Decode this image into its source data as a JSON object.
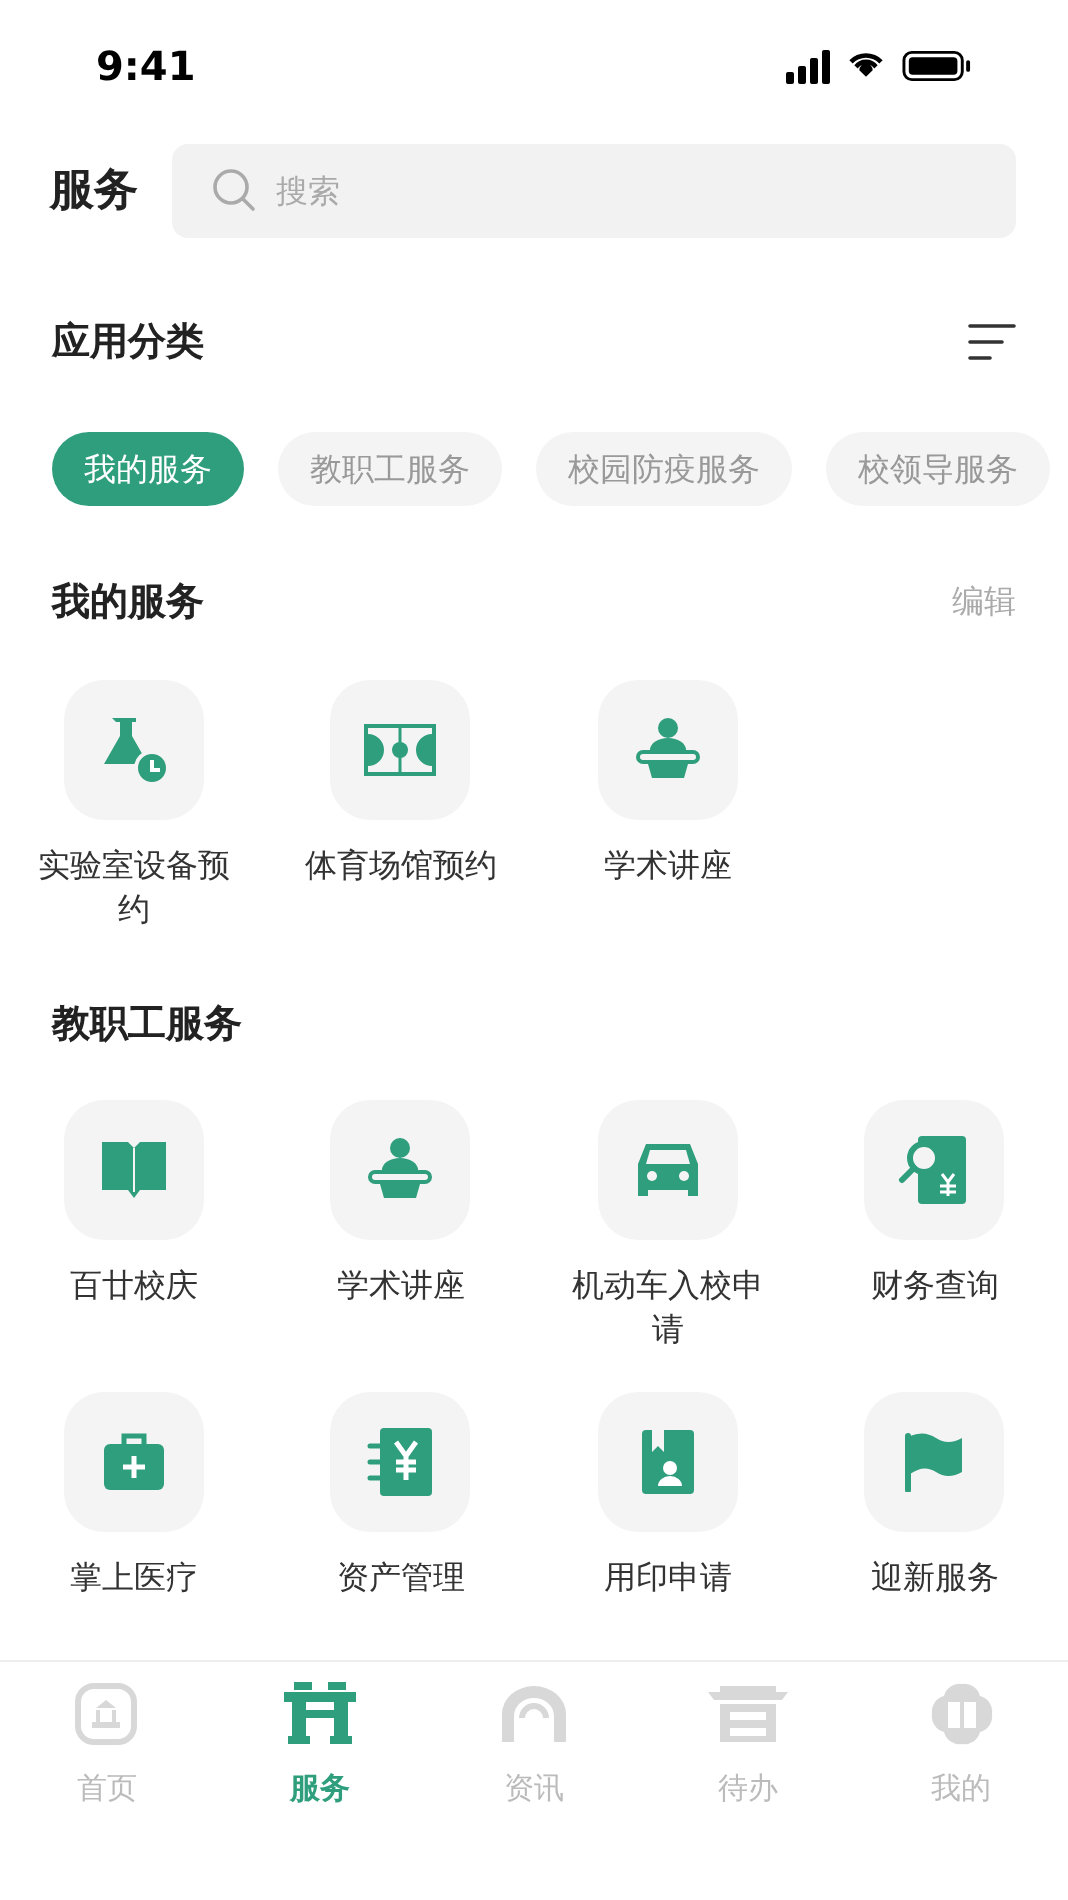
{
  "status_bar": {
    "time": "9:41"
  },
  "header": {
    "title": "服务",
    "search": {
      "placeholder": "搜索"
    }
  },
  "category": {
    "title": "应用分类"
  },
  "chips": [
    {
      "label": "我的服务",
      "selected": true
    },
    {
      "label": "教职工服务",
      "selected": false
    },
    {
      "label": "校园防疫服务",
      "selected": false
    },
    {
      "label": "校领导服务",
      "selected": false
    }
  ],
  "sections": [
    {
      "title": "我的服务",
      "action": "编辑",
      "items": [
        {
          "label": "实验室设备预约"
        },
        {
          "label": "体育场馆预约"
        },
        {
          "label": "学术讲座"
        }
      ]
    },
    {
      "title": "教职工服务",
      "items": [
        {
          "label": "百廿校庆"
        },
        {
          "label": "学术讲座"
        },
        {
          "label": "机动车入校申请"
        },
        {
          "label": "财务查询"
        },
        {
          "label": "掌上医疗"
        },
        {
          "label": "资产管理"
        },
        {
          "label": "用印申请"
        },
        {
          "label": "迎新服务"
        }
      ]
    }
  ],
  "tab_bar": [
    {
      "label": "首页",
      "selected": false
    },
    {
      "label": "服务",
      "selected": true
    },
    {
      "label": "资讯",
      "selected": false
    },
    {
      "label": "待办",
      "selected": false
    },
    {
      "label": "我的",
      "selected": false
    }
  ]
}
